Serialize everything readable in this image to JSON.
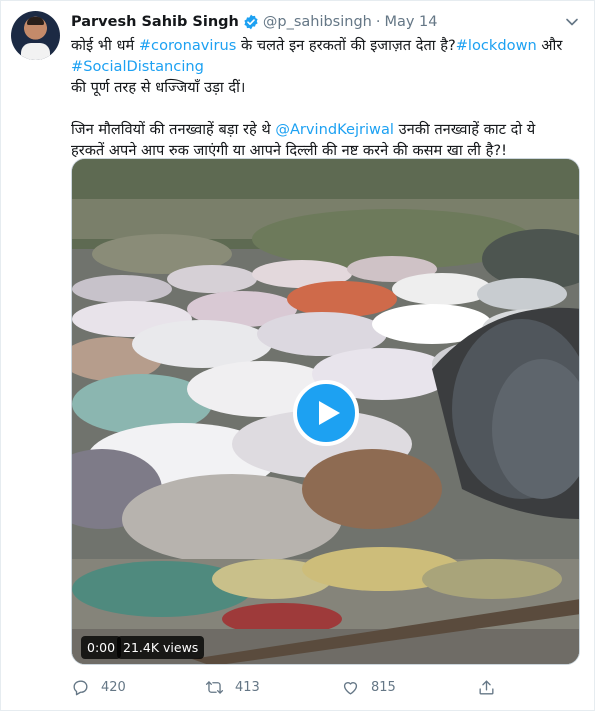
{
  "tweet": {
    "author_name": "Parvesh Sahib Singh",
    "handle": "@p_sahibsingh",
    "separator": "·",
    "date": "May 14",
    "line1_pre": "कोई भी धर्म ",
    "line1_tag1": "#coronavirus",
    "line1_mid": " के चलते इन हरकतों की इजाज़त देता है?",
    "line1_tag2": "#lockdown",
    "line1_post": " और",
    "line2_tag": "#SocialDistancing",
    "line3": "की पूर्ण तरह से धज्जियाँ उड़ा दीं।",
    "line4_pre": "जिन मौलवियों की तनख्वाहें बड़ा रहे थे ",
    "line4_mention": "@ArvindKejriwal",
    "line4_post": " उनकी तनख्वाहें काट दो ये",
    "line5": "हरकतें अपने आप रुक जाएंगी या आपने दिल्ली की नष्ट करने की कसम खा ली है?!"
  },
  "video": {
    "time": "0:00",
    "views": "21.4K views"
  },
  "actions": {
    "reply_count": "420",
    "retweet_count": "413",
    "like_count": "815"
  },
  "colors": {
    "link": "#1da1f2",
    "secondary": "#657786",
    "text": "#14171a"
  },
  "icons": [
    "verified-badge-icon",
    "chevron-down-icon",
    "play-icon",
    "reply-icon",
    "retweet-icon",
    "like-icon",
    "share-icon"
  ]
}
